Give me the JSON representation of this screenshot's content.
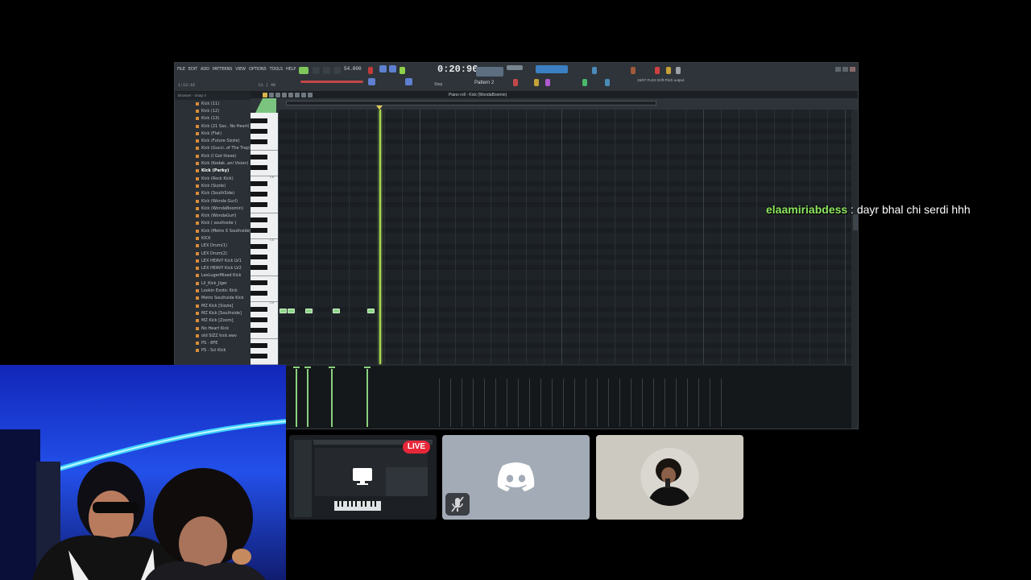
{
  "fl": {
    "menu": [
      "FILE",
      "EDIT",
      "ADD",
      "PATTERNS",
      "VIEW",
      "OPTIONS",
      "TOOLS",
      "HELP"
    ],
    "time_sig": "1:12:16",
    "cpu": "C1 | 48",
    "tempo": "54.000",
    "clock": "0:20:96",
    "snap": "Step",
    "pattern": "Pattern 2",
    "hint": "15/07 FLEX Drift Pitch output",
    "browser_header": "Browser - Snap 4",
    "browser_items": [
      "Kick (11)",
      "Kick (12)",
      "Kick (13)",
      "Kick (21 Sav.. No Heart)",
      "Kick (Flat)",
      "Kick (Future Sizzle)",
      "Kick (Gucci..of The Trap)",
      "Kick (I Got these)",
      "Kick (Kodak..ani Vision)",
      "Kick (Perky)",
      "Kick (Rock Kick)",
      "Kick (Sizzle)",
      "Kick (SouthSide)",
      "Kick (Wonda Gurl)",
      "Kick (WondaBoomin)",
      "Kick (WondaGurl)",
      "Kick ( southside )",
      "Kick (Metro X Southside)",
      "KICK",
      "LEX Drum(1)",
      "LEX Drum(2)",
      "LEX HEAVY Kick LV1",
      "LEX HEAVY Kick LV2",
      "LexLugerMixed Kick",
      "Lil_Kick_Jiger",
      "Lookin Exotic Kick",
      "Metro Southside Kick",
      "MZ Kick [Sizzle]",
      "MZ Kick [Southside]",
      "MZ Kick [Zoom]",
      "No Heart Kick",
      "old SIZZ kick.wav",
      "PS - 8FE",
      "PS - Sci Kick"
    ],
    "selected_index": 9,
    "piano_roll_title": "Piano roll - Kick (WondaBoomin)",
    "octave_labels": [
      "C6",
      "C5",
      "C4"
    ]
  },
  "chat": {
    "user": "elaamiriabdess",
    "message": " : dayr bhal chi serdi hhh"
  },
  "discord": {
    "live": "LIVE"
  }
}
